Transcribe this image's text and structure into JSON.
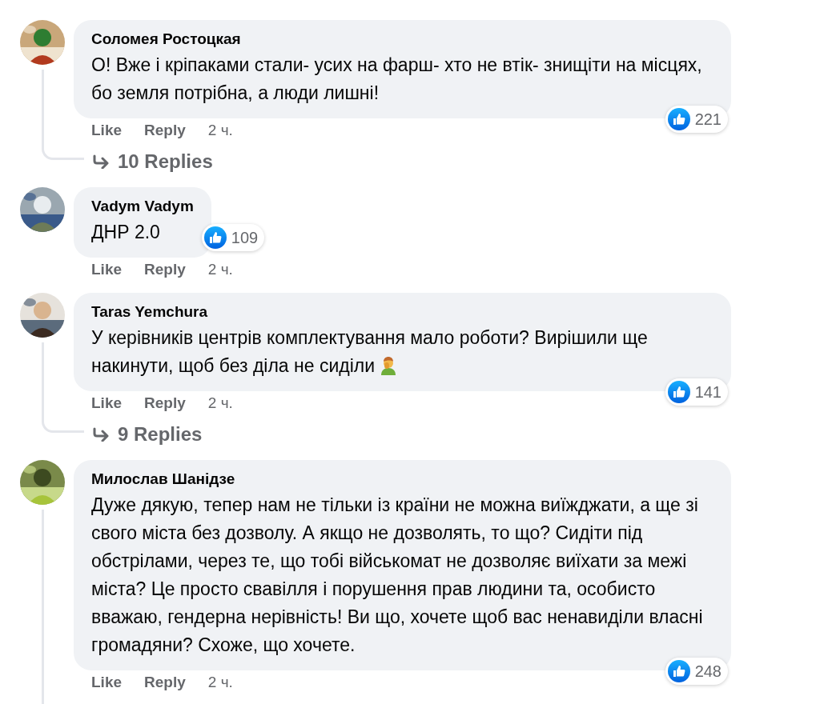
{
  "comments": [
    {
      "author": "Соломея Ростоцкая",
      "text": "О! Вже і кріпаками стали- усих на фарш- хто не втік- знищіти на місцях, бо земля потрібна, а люди лишні!",
      "actions": [
        "Like",
        "Reply"
      ],
      "time": "2 ч.",
      "reactions": "221",
      "thread": true,
      "replies": "10 Replies"
    },
    {
      "author": "Vadym Vadym",
      "text": "ДНР 2.0",
      "actions": [
        "Like",
        "Reply"
      ],
      "time": "2 ч.",
      "reactions": "109",
      "thread": false
    },
    {
      "author": "Taras Yemchura",
      "text": "У керівників центрів комплектування мало роботи? Вирішили ще накинути, щоб без діла не сиділи",
      "actions": [
        "Like",
        "Reply"
      ],
      "time": "2 ч.",
      "reactions": "141",
      "thread": true,
      "replies": "9 Replies",
      "emoji": true
    },
    {
      "author": "Милослав Шанідзе",
      "text": "Дуже дякую, тепер нам не тільки із країни не можна виїжджати, а ще зі свого міста без дозволу. А якщо не дозволять, то що? Сидіти під обстрілами, через те, що тобі військомат не дозволяє виїхати за межі міста? Це просто свавілля і порушення прав людини та, особисто вважаю, гендерна нерівність! Ви що, хочете щоб вас ненавиділи власні громадяни? Схоже, що хочете.",
      "actions": [
        "Like",
        "Reply"
      ],
      "time": "2 ч.",
      "reactions": "248",
      "thread": true
    }
  ]
}
